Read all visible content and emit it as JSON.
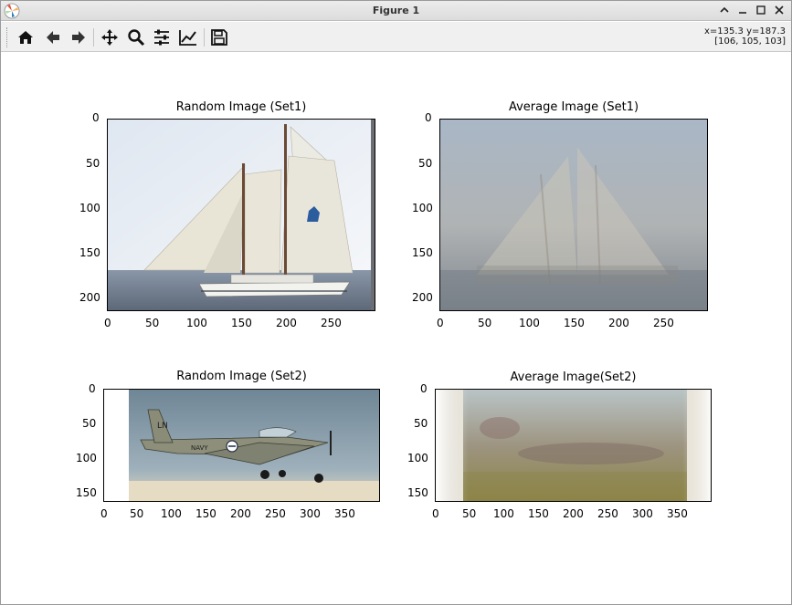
{
  "window": {
    "title": "Figure 1"
  },
  "toolbar": {
    "buttons": [
      {
        "name": "home-icon"
      },
      {
        "name": "back-icon"
      },
      {
        "name": "forward-icon"
      },
      {
        "name": "pan-icon"
      },
      {
        "name": "zoom-icon"
      },
      {
        "name": "configure-subplots-icon"
      },
      {
        "name": "edit-axis-icon"
      },
      {
        "name": "save-icon"
      }
    ],
    "coords_line1": "x=135.3 y=187.3",
    "coords_line2": "[106, 105, 103]"
  },
  "subplots": {
    "s1": {
      "title": "Random Image (Set1)",
      "xticks": [
        "0",
        "50",
        "100",
        "150",
        "200",
        "250"
      ],
      "yticks": [
        "0",
        "50",
        "100",
        "150",
        "200"
      ]
    },
    "s2": {
      "title": "Average Image (Set1)",
      "xticks": [
        "0",
        "50",
        "100",
        "150",
        "200",
        "250"
      ],
      "yticks": [
        "0",
        "50",
        "100",
        "150",
        "200"
      ]
    },
    "s3": {
      "title": "Random Image (Set2)",
      "xticks": [
        "0",
        "50",
        "100",
        "150",
        "200",
        "250",
        "300",
        "350"
      ],
      "yticks": [
        "0",
        "50",
        "100",
        "150"
      ]
    },
    "s4": {
      "title": "Average Image(Set2)",
      "xticks": [
        "0",
        "50",
        "100",
        "150",
        "200",
        "250",
        "300",
        "350"
      ],
      "yticks": [
        "0",
        "50",
        "100",
        "150"
      ]
    }
  },
  "plane_text": {
    "tail": "LN",
    "fuselage": "NAVY"
  }
}
